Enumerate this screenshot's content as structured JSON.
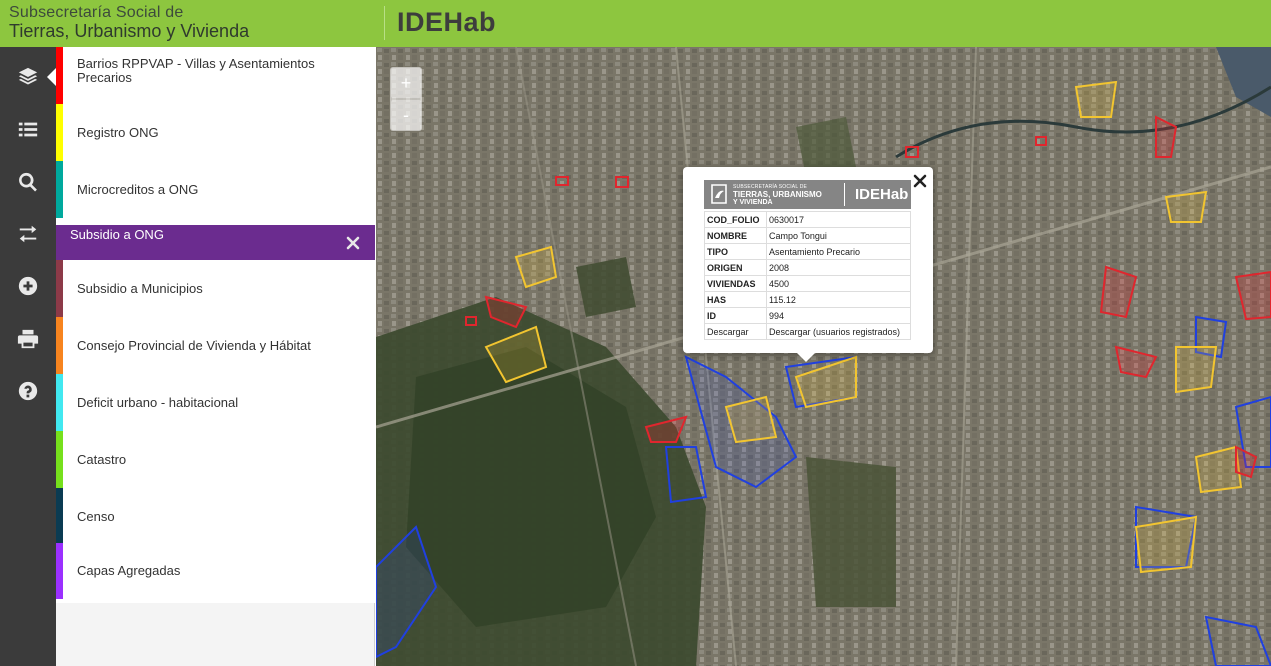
{
  "header": {
    "org_line1": "Subsecretaría Social de",
    "org_line2": "Tierras, Urbanismo y Vivienda",
    "app_title": "IDEHab"
  },
  "rail": {
    "buttons": [
      {
        "icon": "layers-icon"
      },
      {
        "icon": "list-icon"
      },
      {
        "icon": "search-icon"
      },
      {
        "icon": "swap-arrows-icon"
      },
      {
        "icon": "plus-circle-icon"
      },
      {
        "icon": "print-icon"
      },
      {
        "icon": "help-icon"
      }
    ]
  },
  "layers": [
    {
      "label": "Barrios RPPVAP - Villas y Asentamientos Precarios",
      "color": "#ff0000"
    },
    {
      "label": "Registro ONG",
      "color": "#ffff00"
    },
    {
      "label": "Microcreditos a ONG",
      "color": "#00a99d"
    },
    {
      "label": "Subsidio a ONG",
      "color": "#6b2c8f",
      "active": true
    },
    {
      "label": "Subsidio a Municipios",
      "color": "#8c3a48"
    },
    {
      "label": "Consejo Provincial de Vivienda y Hábitat",
      "color": "#f7841f"
    },
    {
      "label": "Deficit urbano - habitacional",
      "color": "#41e8f0"
    },
    {
      "label": "Catastro",
      "color": "#76e01c"
    },
    {
      "label": "Censo",
      "color": "#0b3b52"
    },
    {
      "label": "Capas Agregadas",
      "color": "#9b30ff"
    }
  ],
  "map": {
    "zoom_in": "+",
    "zoom_out": "-"
  },
  "popup": {
    "logo_line1": "SUBSECRETARÍA SOCIAL DE",
    "logo_line2": "TIERRAS, URBANISMO",
    "logo_line3": "Y VIVIENDA",
    "logo_app": "IDEHab",
    "rows": [
      {
        "key": "COD_FOLIO",
        "value": "0630017"
      },
      {
        "key": "NOMBRE",
        "value": "Campo Tongui"
      },
      {
        "key": "TIPO",
        "value": "Asentamiento Precario"
      },
      {
        "key": "ORIGEN",
        "value": "2008"
      },
      {
        "key": "VIVIENDAS",
        "value": "4500"
      },
      {
        "key": "HAS",
        "value": "115.12"
      },
      {
        "key": "ID",
        "value": "994"
      }
    ],
    "download_key": "Descargar",
    "download_value": "Descargar (usuarios registrados)"
  },
  "colors": {
    "header_green": "#8dc63f",
    "rail_dark": "#3b3b3b",
    "polygon_red": "#e0262e",
    "polygon_yellow": "#f2c530",
    "polygon_blue": "#2040e0"
  }
}
